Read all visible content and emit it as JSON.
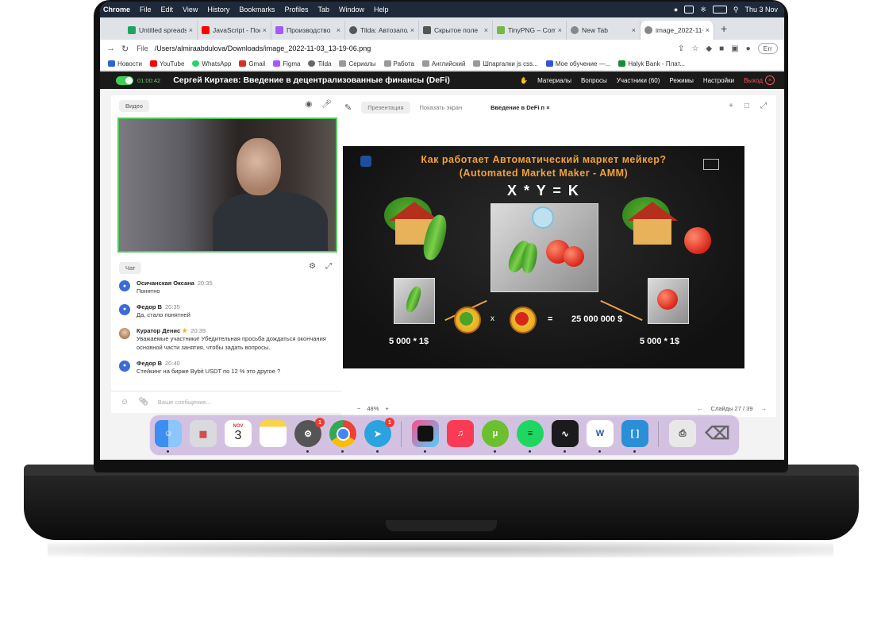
{
  "menubar": {
    "app": "Chrome",
    "items": [
      "File",
      "Edit",
      "View",
      "History",
      "Bookmarks",
      "Profiles",
      "Tab",
      "Window",
      "Help"
    ],
    "clock": "Thu 3 Nov"
  },
  "tabs": [
    {
      "label": "Untitled spreadsheet",
      "color": "#1fa463"
    },
    {
      "label": "JavaScript - Понятный",
      "color": "#ff0000"
    },
    {
      "label": "Производство",
      "color": "#a259ff"
    },
    {
      "label": "Tilda: Автозапол",
      "color": "#555555"
    },
    {
      "label": "Скрытое поле",
      "color": "#555555"
    },
    {
      "label": "TinyPNG – Compress",
      "color": "#7ab648"
    },
    {
      "label": "New Tab",
      "color": "#888888"
    },
    {
      "label": "image_2022-11-03",
      "color": "#888888"
    }
  ],
  "address": {
    "file_label": "File",
    "url": "/Users/almiraabdulova/Downloads/image_2022-11-03_13-19-06.png",
    "err_label": "Err"
  },
  "bookmarks": [
    {
      "label": "Новости",
      "color": "#2a64d9"
    },
    {
      "label": "YouTube",
      "color": "#ff0000"
    },
    {
      "label": "WhatsApp",
      "color": "#25d366"
    },
    {
      "label": "Gmail",
      "color": "#d93025"
    },
    {
      "label": "Figma",
      "color": "#a259ff"
    },
    {
      "label": "Tilda",
      "color": "#666666"
    },
    {
      "label": "Сериалы",
      "color": "#999999"
    },
    {
      "label": "Работа",
      "color": "#999999"
    },
    {
      "label": "Английский",
      "color": "#999999"
    },
    {
      "label": "Шпаргалки js css...",
      "color": "#999999"
    },
    {
      "label": "Мое обучение —...",
      "color": "#3a52d8"
    },
    {
      "label": "Halyk Bank - Плат...",
      "color": "#1b8a3a"
    }
  ],
  "webinar": {
    "timer": "01:00:42",
    "title": "Сергей Киртаев: Введение в децентрализованные финансы (DeFi)",
    "menu": [
      "Материалы",
      "Вопросы",
      "Участники (60)",
      "Режимы",
      "Настройки"
    ],
    "exit": "Выход"
  },
  "left": {
    "video_tab": "Видео",
    "chat_tab": "Чат",
    "messages": [
      {
        "name": "Осичанская Оксана",
        "time": "20:35",
        "text": "Понятно",
        "star": false
      },
      {
        "name": "Федор В",
        "time": "20:35",
        "text": "Да, стало понятней",
        "star": false
      },
      {
        "name": "Куратор Денис",
        "time": "20:39",
        "text": "Уважаемые участники! Убедительная просьба дождаться окончания основной части занятия, чтобы задать вопросы.",
        "star": true
      },
      {
        "name": "Федор В",
        "time": "20:40",
        "text": "Стейкинг на бирже Bybit USDT по 12 % это другое ?",
        "star": false
      }
    ],
    "message_placeholder": "Ваше сообщение..."
  },
  "right": {
    "tab_presentation": "Презентация",
    "tab_screen": "Показать экран",
    "tab_current": "Введение в DeFi п",
    "zoom": "48%",
    "slides_label": "Слайды 27 / 39"
  },
  "slide": {
    "title1": "Как работает Автоматический маркет мейкер?",
    "title2": "(Automated Market Maker - AMM)",
    "formula": "X * Y = K",
    "left_value": "5 000 * 1$",
    "right_value": "5 000 * 1$",
    "times": "x",
    "equals": "=",
    "product": "25 000 000 $"
  },
  "dock": {
    "calendar_month": "NOV",
    "calendar_day": "3",
    "badge_settings": "1",
    "badge_telegram": "1"
  }
}
